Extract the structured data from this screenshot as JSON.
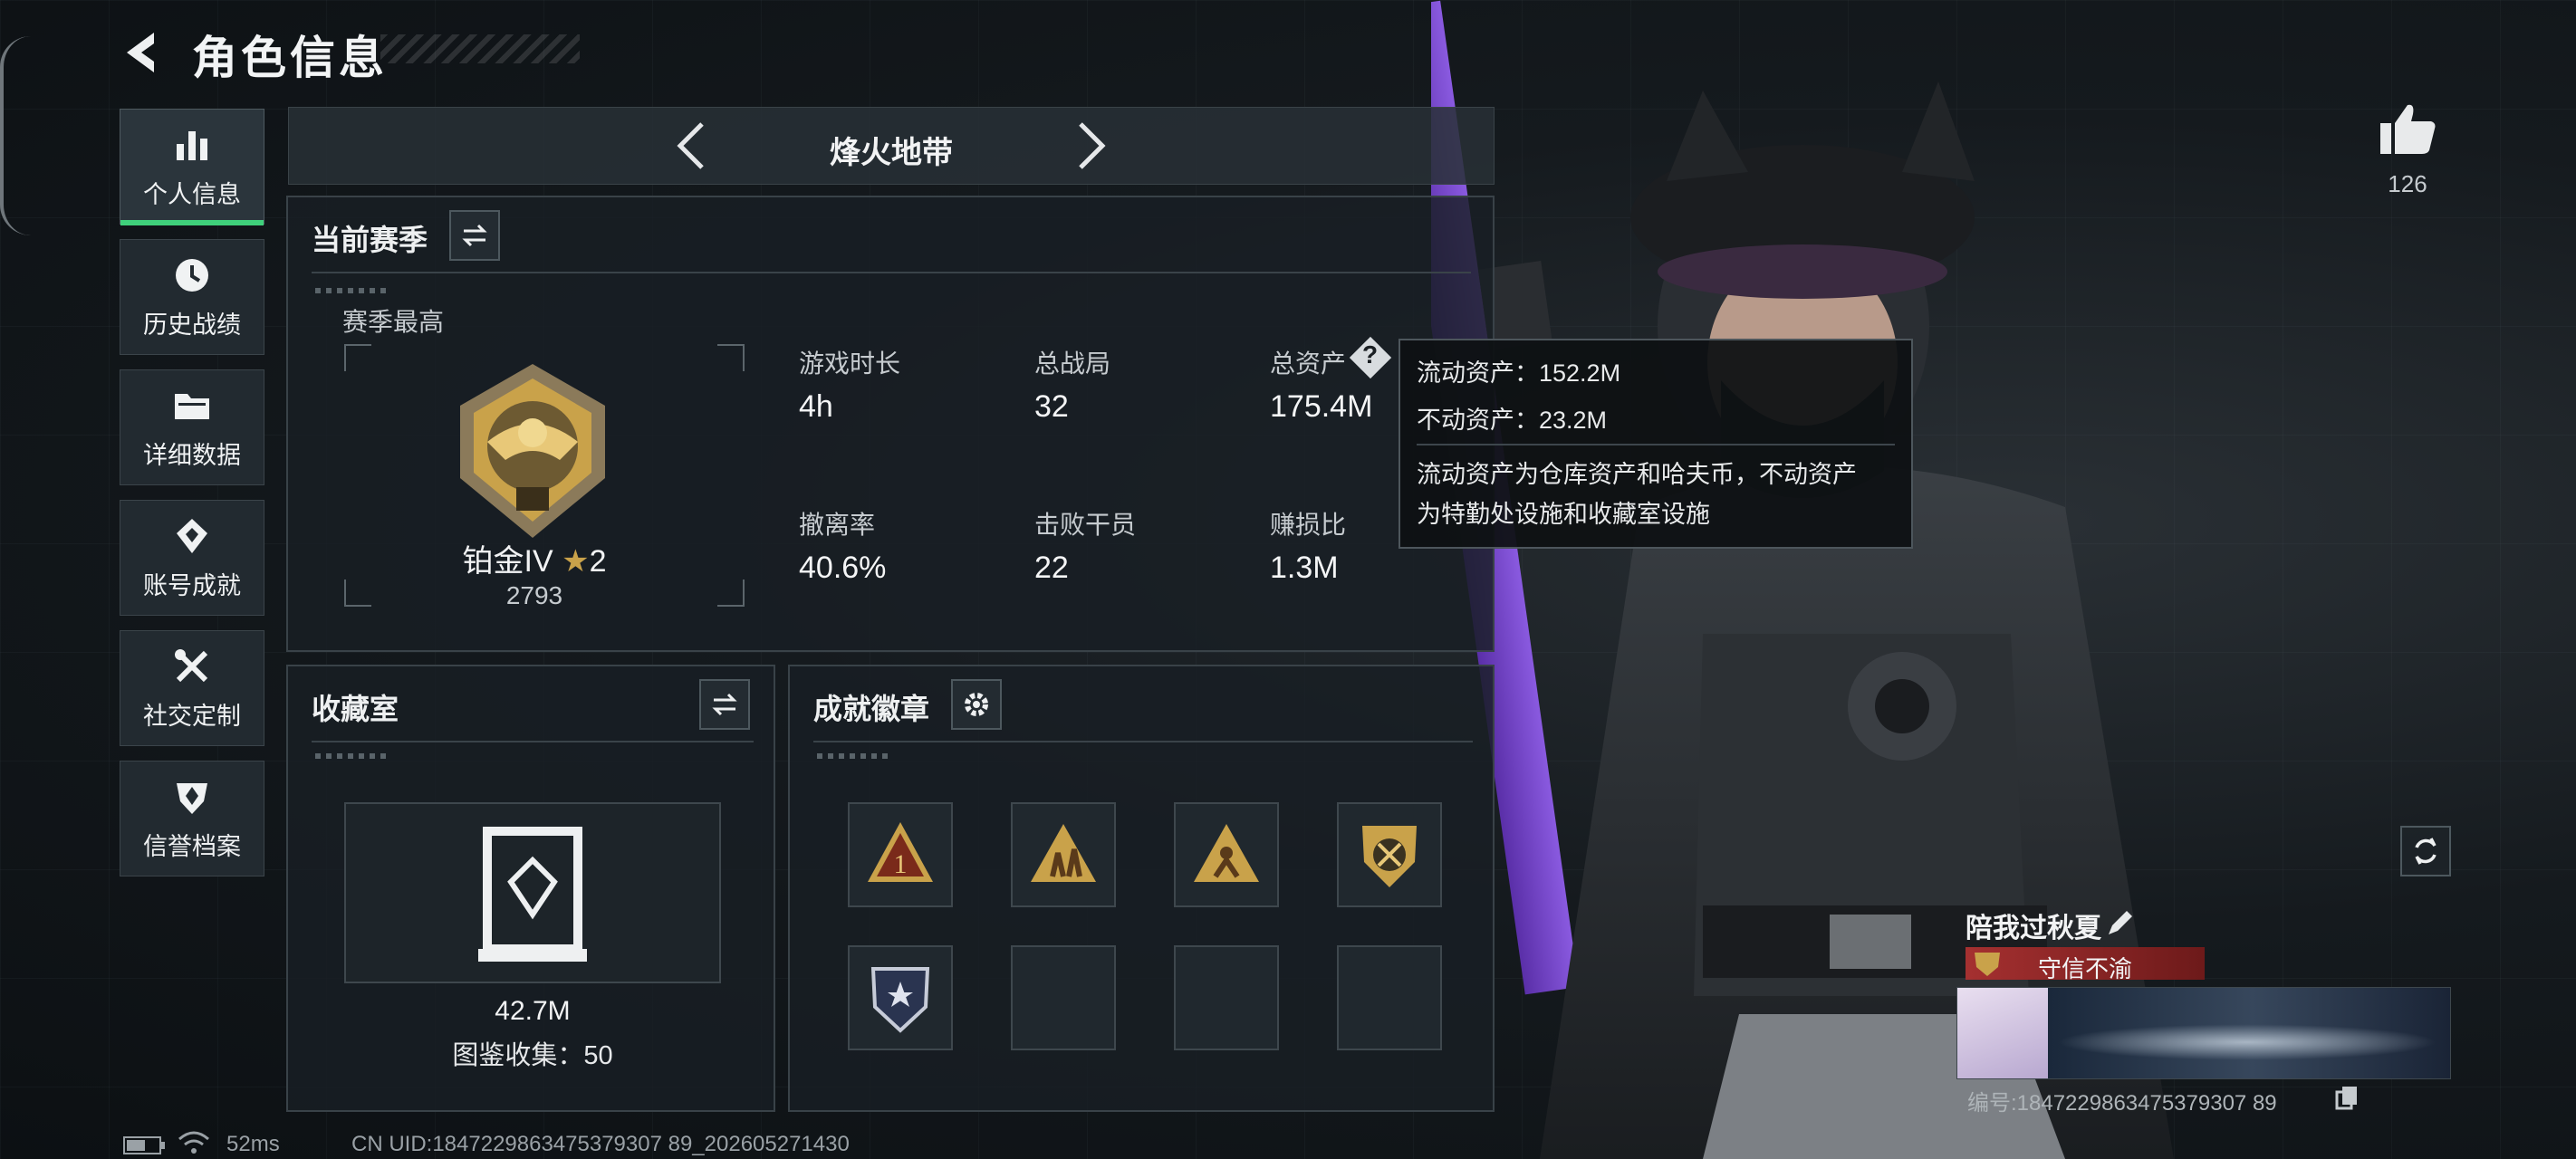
{
  "header": {
    "title": "角色信息"
  },
  "sidebar": {
    "items": [
      {
        "label": "个人信息",
        "icon": "bar-chart-icon"
      },
      {
        "label": "历史战绩",
        "icon": "clock-icon"
      },
      {
        "label": "详细数据",
        "icon": "folder-icon"
      },
      {
        "label": "账号成就",
        "icon": "achievement-icon"
      },
      {
        "label": "社交定制",
        "icon": "tools-icon"
      },
      {
        "label": "信誉档案",
        "icon": "shield-icon"
      }
    ]
  },
  "tabbar": {
    "title": "烽火地带"
  },
  "season": {
    "title": "当前赛季",
    "best_label": "赛季最高",
    "rank_name": "铂金IV",
    "rank_stars": "2",
    "rank_score": "2793",
    "stats": [
      {
        "label": "游戏时长",
        "value": "4h"
      },
      {
        "label": "总战局",
        "value": "32"
      },
      {
        "label": "总资产",
        "value": "175.4M"
      },
      {
        "label": "撤离率",
        "value": "40.6%"
      },
      {
        "label": "击败干员",
        "value": "22"
      },
      {
        "label": "赚损比",
        "value": "1.3M"
      }
    ]
  },
  "tooltip": {
    "liquid": "流动资产：152.2M",
    "fixed": "不动资产：23.2M",
    "desc1": "流动资产为仓库资产和哈夫币，不动资产",
    "desc2": "为特勤处设施和收藏室设施"
  },
  "collection": {
    "title": "收藏室",
    "value": "42.7M",
    "count_text": "图鉴收集：50"
  },
  "badges": {
    "title": "成就徽章"
  },
  "likes": {
    "count": "126"
  },
  "profile": {
    "name": "陪我过秋夏",
    "title_tag": "守信不渝",
    "id_text": "编号:1847229863475379307 89"
  },
  "status": {
    "ping": "52ms",
    "uid": "CN UID:1847229863475379307 89_202605271430"
  },
  "colors": {
    "accent_green": "#3fd07b",
    "gold": "#c9a24a",
    "tag_red": "#8a1d1d"
  }
}
